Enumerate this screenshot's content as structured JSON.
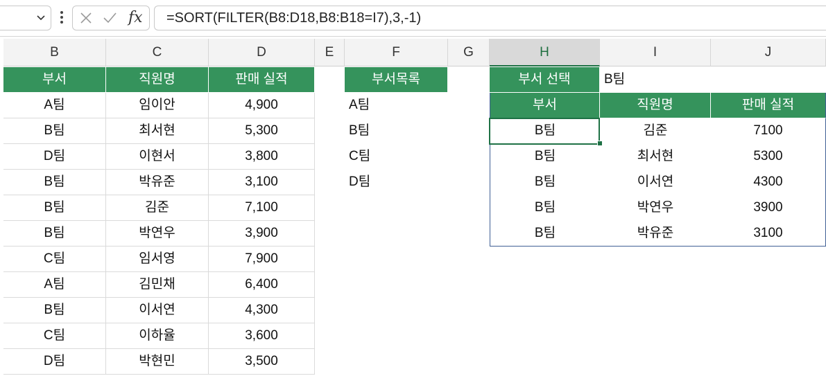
{
  "formula_bar": {
    "name_box_value": "",
    "fx_label": "fx",
    "formula": "=SORT(FILTER(B8:D18,B8:B18=I7),3,-1)"
  },
  "columns": [
    "B",
    "C",
    "D",
    "E",
    "F",
    "G",
    "H",
    "I",
    "J"
  ],
  "selected_column": "H",
  "source_table": {
    "headers": [
      "부서",
      "직원명",
      "판매 실적"
    ],
    "rows": [
      [
        "A팀",
        "임이안",
        "4,900"
      ],
      [
        "B팀",
        "최서현",
        "5,300"
      ],
      [
        "D팀",
        "이현서",
        "3,800"
      ],
      [
        "B팀",
        "박유준",
        "3,100"
      ],
      [
        "B팀",
        "김준",
        "7,100"
      ],
      [
        "B팀",
        "박연우",
        "3,900"
      ],
      [
        "C팀",
        "임서영",
        "7,900"
      ],
      [
        "A팀",
        "김민채",
        "6,400"
      ],
      [
        "B팀",
        "이서연",
        "4,300"
      ],
      [
        "C팀",
        "이하율",
        "3,600"
      ],
      [
        "D팀",
        "박현민",
        "3,500"
      ]
    ]
  },
  "dept_list": {
    "header": "부서목록",
    "items": [
      "A팀",
      "B팀",
      "C팀",
      "D팀"
    ]
  },
  "selector": {
    "label": "부서 선택",
    "value": "B팀"
  },
  "result_table": {
    "headers": [
      "부서",
      "직원명",
      "판매 실적"
    ],
    "rows": [
      [
        "B팀",
        "김준",
        "7100"
      ],
      [
        "B팀",
        "최서현",
        "5300"
      ],
      [
        "B팀",
        "이서연",
        "4300"
      ],
      [
        "B팀",
        "박연우",
        "3900"
      ],
      [
        "B팀",
        "박유준",
        "3100"
      ]
    ]
  },
  "colors": {
    "header_green": "#35935c",
    "selection_green": "#1e7145",
    "spill_border_blue": "#3e5e94"
  }
}
